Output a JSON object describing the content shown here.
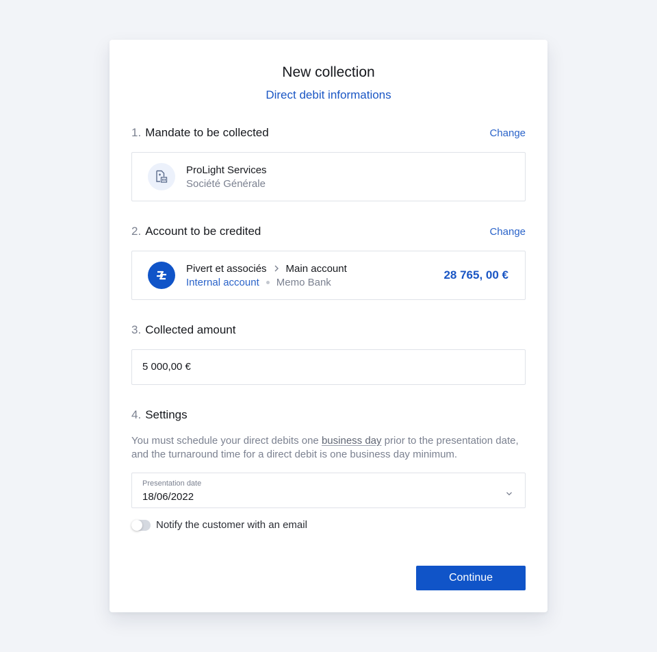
{
  "modal": {
    "title": "New collection",
    "subtitle": "Direct debit informations"
  },
  "sections": {
    "mandate": {
      "number": "1.",
      "title": "Mandate to be collected",
      "change_label": "Change",
      "name": "ProLight Services",
      "bank": "Société Générale",
      "icon": "document-bank-icon"
    },
    "account": {
      "number": "2.",
      "title": "Account to be credited",
      "change_label": "Change",
      "company": "Pivert et associés",
      "account_name": "Main account",
      "account_type": "Internal account",
      "bank": "Memo Bank",
      "balance": "28 765, 00 €",
      "icon": "memo-bank-logo-icon"
    },
    "amount": {
      "number": "3.",
      "title": "Collected amount",
      "value": "5 000,00 €"
    },
    "settings": {
      "number": "4.",
      "title": "Settings",
      "description_before": "You must schedule your direct debits one ",
      "description_link": "business day",
      "description_after": " prior to the presentation date, and the turnaround time for a direct debit is one business day minimum.",
      "date_label": "Presentation date",
      "date_value": "18/06/2022",
      "notify_label": "Notify the customer with an email",
      "notify_enabled": false
    }
  },
  "actions": {
    "continue_label": "Continue"
  },
  "colors": {
    "accent": "#1054c8",
    "link": "#2a63c9",
    "background": "#f2f4f8"
  }
}
